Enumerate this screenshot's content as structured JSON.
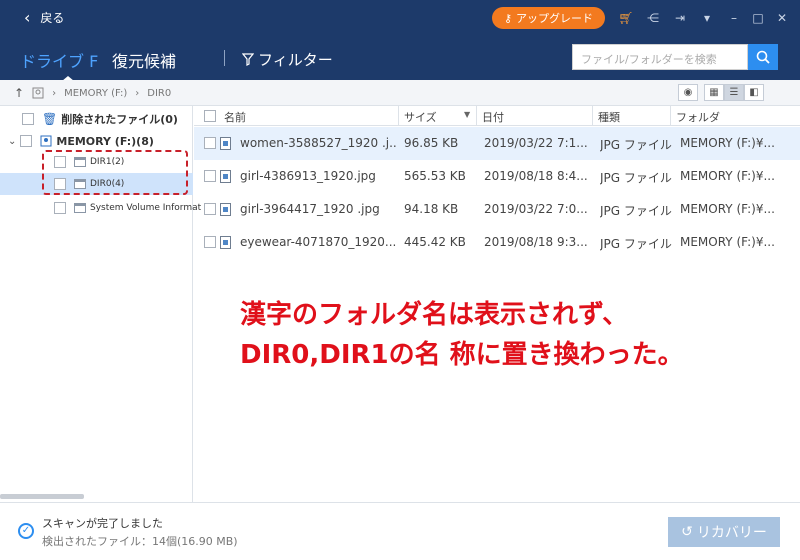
{
  "titlebar": {
    "back_label": "戻る",
    "upgrade_label": "アップグレード",
    "accent": "#f37a1f",
    "icons": [
      "cart-icon",
      "share-icon",
      "signin-icon",
      "menu-icon",
      "minimize-icon",
      "maximize-icon",
      "close-icon"
    ]
  },
  "nav": {
    "tab_drive": "ドライブ F",
    "tab_recover": "復元候補",
    "filter_label": "フィルター",
    "search_placeholder": "ファイル/フォルダーを検索"
  },
  "breadcrumb": {
    "drive": "MEMORY (F:)",
    "folder": "DIR0"
  },
  "tree": {
    "deleted": "削除されたファイル(0)",
    "memory": "MEMORY (F:)(8)",
    "dir1": "DIR1(2)",
    "dir0": "DIR0(4)",
    "sysvol": "System Volume Informat"
  },
  "table": {
    "headers": [
      "名前",
      "サイズ",
      "日付",
      "種類",
      "フォルダ"
    ],
    "rows": [
      [
        "women-3588527_1920 .j...",
        "96.85 KB",
        "2019/03/22 7:1...",
        "JPG ファイル",
        "MEMORY (F:)¥..."
      ],
      [
        "girl-4386913_1920.jpg",
        "565.53 KB",
        "2019/08/18 8:4...",
        "JPG ファイル",
        "MEMORY (F:)¥..."
      ],
      [
        "girl-3964417_1920 .jpg",
        "94.18 KB",
        "2019/03/22 7:0...",
        "JPG ファイル",
        "MEMORY (F:)¥..."
      ],
      [
        "eyewear-4071870_1920....",
        "445.42 KB",
        "2019/08/18 9:3...",
        "JPG ファイル",
        "MEMORY (F:)¥..."
      ]
    ]
  },
  "annotation": {
    "line1": "漢字のフォルダ名は表示されず、",
    "line2": "DIR0,DIR1の名 称に置き換わった。",
    "color": "#e0101a"
  },
  "footer": {
    "scan_done": "スキャンが完了しました",
    "found": "検出されたファイル：14個(16.90 MB)",
    "recover_label": "リカバリー"
  }
}
